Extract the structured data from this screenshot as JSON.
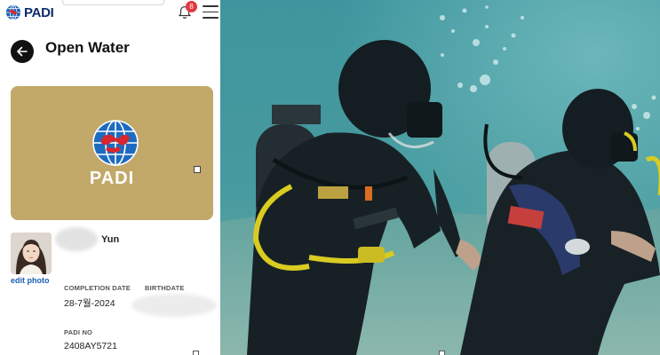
{
  "header": {
    "logo_text": "PADI",
    "notification_count": "8",
    "icons": [
      "padi-globe-icon",
      "bell-icon",
      "hamburger-menu-icon"
    ]
  },
  "page": {
    "title": "Open Water"
  },
  "card": {
    "brand": "PADI",
    "background_color": "#c2a96a"
  },
  "profile": {
    "name_visible": "Yun",
    "edit_photo_label": "edit photo"
  },
  "details": {
    "completion_date_label": "COMPLETION DATE",
    "completion_date_value": "28-7월-2024",
    "birthdate_label": "BIRTHDATE",
    "padi_no_label": "PADI NO",
    "padi_no_value": "2408AY5721"
  },
  "photo": {
    "description_colors": {
      "water": "#3c8f97",
      "wetsuit": "#161a1f",
      "regulator_hose": "#e8d21a"
    }
  }
}
